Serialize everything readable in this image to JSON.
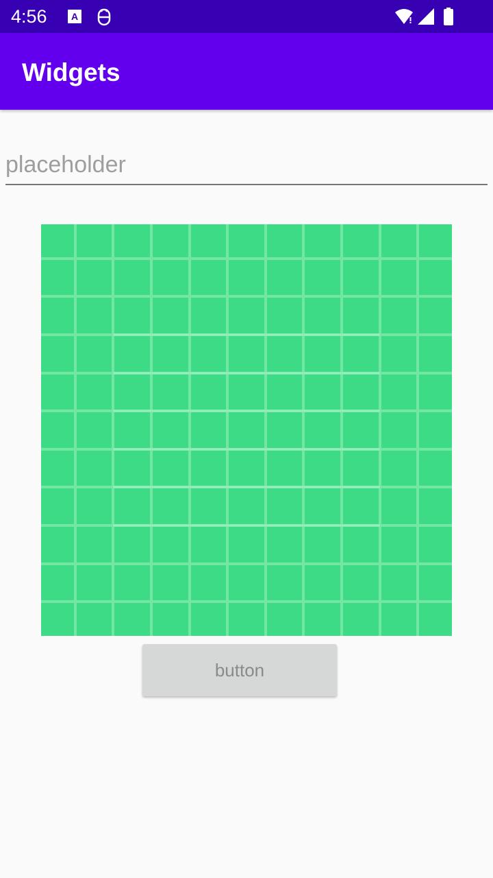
{
  "status_bar": {
    "time": "4:56",
    "icons": [
      "text-a-notification-icon",
      "debug-notification-icon",
      "wifi-icon",
      "signal-icon",
      "battery-icon"
    ]
  },
  "app_bar": {
    "title": "Widgets"
  },
  "input": {
    "value": "",
    "placeholder": "placeholder"
  },
  "image": {
    "icon": "placeholder-grid-image"
  },
  "button": {
    "label": "button"
  },
  "colors": {
    "status_bar": "#3700b3",
    "app_bar": "#6200ee",
    "grid_fill": "#3ddb85",
    "grid_line": "#7ee9aa",
    "button_bg": "#d6d7d7",
    "background": "#fafafa"
  }
}
